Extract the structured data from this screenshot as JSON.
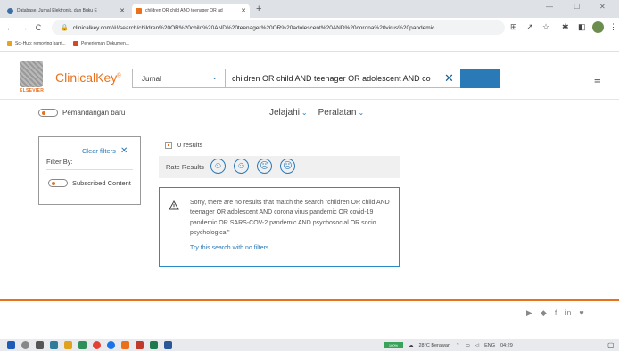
{
  "browser": {
    "tabs": [
      {
        "title": "Database, Jurnal Elektronik, dan Buku E",
        "active": false,
        "favicon_color": "#3b6ea5"
      },
      {
        "title": "children OR child AND teenager OR ad",
        "active": true,
        "favicon_color": "#e9711c"
      }
    ],
    "new_tab": "+",
    "window_controls": {
      "minimize": "—",
      "maximize": "☐",
      "close": "✕"
    },
    "back": "←",
    "forward": "→",
    "reload": "C",
    "url": "clinicalkey.com/#!/search/children%20OR%20child%20AND%20teenager%20OR%20adolescent%20AND%20corona%20virus%20pandemic...",
    "bookmarks": [
      {
        "label": "Sci-Hub: removing barri...",
        "color": "#e9a21c"
      },
      {
        "label": "Penerjemah Dokumen...",
        "color": "#d9481c"
      }
    ]
  },
  "site": {
    "publisher": "ELSEVIER",
    "brand": "ClinicalKey",
    "brand_mark": "®",
    "scope": "Jurnal",
    "query": "children OR child AND teenager OR adolescent AND co",
    "new_view": "Pemandangan baru",
    "nav": [
      {
        "label": "Jelajahi"
      },
      {
        "label": "Peralatan"
      }
    ]
  },
  "filters": {
    "clear": "Clear filters",
    "title": "Filter By:",
    "subscribed": "Subscribed Content"
  },
  "results": {
    "count": "0 results",
    "rate_label": "Rate Results",
    "faces": [
      "☺",
      "☺",
      "☹",
      "☹"
    ],
    "message": "Sorry, there are no results that match the search \"children OR child AND teenager OR adolescent AND corona virus pandemic OR covid-19 pandemic OR SARS-COV-2 pandemic AND psychosocial OR socio psychological\"",
    "try_link": "Try this search with no filters"
  },
  "footer": {
    "social": [
      "▶",
      "◆",
      "f",
      "in",
      "♥"
    ]
  },
  "taskbar": {
    "weather": "28°C Berawan",
    "lang": "ENG",
    "time": "04:29",
    "battery": "100%"
  },
  "colors": {
    "brand_orange": "#e9711c",
    "link_blue": "#2b7ab8",
    "info_border": "#2b8ac8"
  }
}
